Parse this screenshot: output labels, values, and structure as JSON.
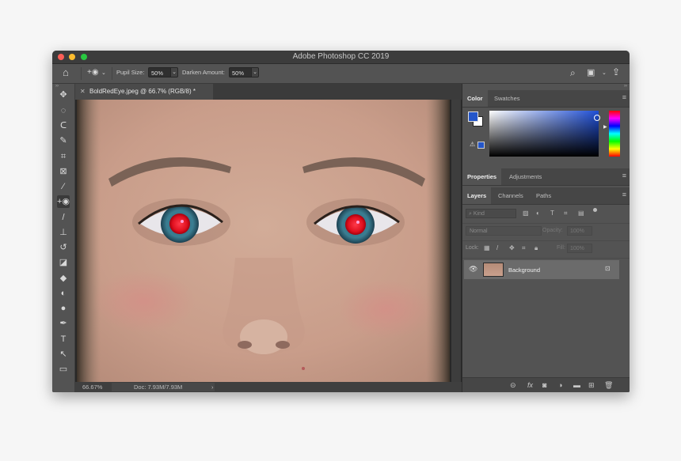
{
  "window": {
    "title": "Adobe Photoshop CC 2019"
  },
  "options": {
    "pupil_label": "Pupil Size:",
    "pupil_value": "50%",
    "darken_label": "Darken Amount:",
    "darken_value": "50%"
  },
  "document": {
    "tab_title": "BoldRedEye.jpeg @ 66.7% (RGB/8) *",
    "zoom": "66.67%",
    "doc_info": "Doc: 7.93M/7.93M"
  },
  "tools": [
    {
      "name": "move-tool",
      "glyph": "✥"
    },
    {
      "name": "marquee-tool",
      "glyph": "◌"
    },
    {
      "name": "lasso-tool",
      "glyph": "ᑕ"
    },
    {
      "name": "quick-select-tool",
      "glyph": "✎"
    },
    {
      "name": "crop-tool",
      "glyph": "⌗"
    },
    {
      "name": "frame-tool",
      "glyph": "⊠"
    },
    {
      "name": "eyedropper-tool",
      "glyph": "⁄"
    },
    {
      "name": "red-eye-tool",
      "glyph": "+◉"
    },
    {
      "name": "brush-tool",
      "glyph": "/"
    },
    {
      "name": "stamp-tool",
      "glyph": "⊥"
    },
    {
      "name": "history-brush-tool",
      "glyph": "↺"
    },
    {
      "name": "eraser-tool",
      "glyph": "◪"
    },
    {
      "name": "paint-bucket-tool",
      "glyph": "◆"
    },
    {
      "name": "blur-tool",
      "glyph": "◐"
    },
    {
      "name": "dodge-tool",
      "glyph": "●"
    },
    {
      "name": "pen-tool",
      "glyph": "✒"
    },
    {
      "name": "type-tool",
      "glyph": "T"
    },
    {
      "name": "path-select-tool",
      "glyph": "↖"
    },
    {
      "name": "rectangle-tool",
      "glyph": "▭"
    }
  ],
  "color_panel": {
    "tabs": [
      "Color",
      "Swatches"
    ],
    "foreground": "#2456c9",
    "background": "#ffffff"
  },
  "properties_panel": {
    "tabs": [
      "Properties",
      "Adjustments"
    ]
  },
  "layers_panel": {
    "tabs": [
      "Layers",
      "Channels",
      "Paths"
    ],
    "filter_kind": "Kind",
    "blend_mode": "Normal",
    "opacity_label": "Opacity:",
    "opacity_value": "100%",
    "lock_label": "Lock:",
    "fill_label": "Fill:",
    "fill_value": "100%",
    "layers": [
      {
        "name": "Background",
        "visible": true,
        "locked": true
      }
    ]
  },
  "colors": {
    "panel": "#535353",
    "accent": "#2456c9"
  }
}
